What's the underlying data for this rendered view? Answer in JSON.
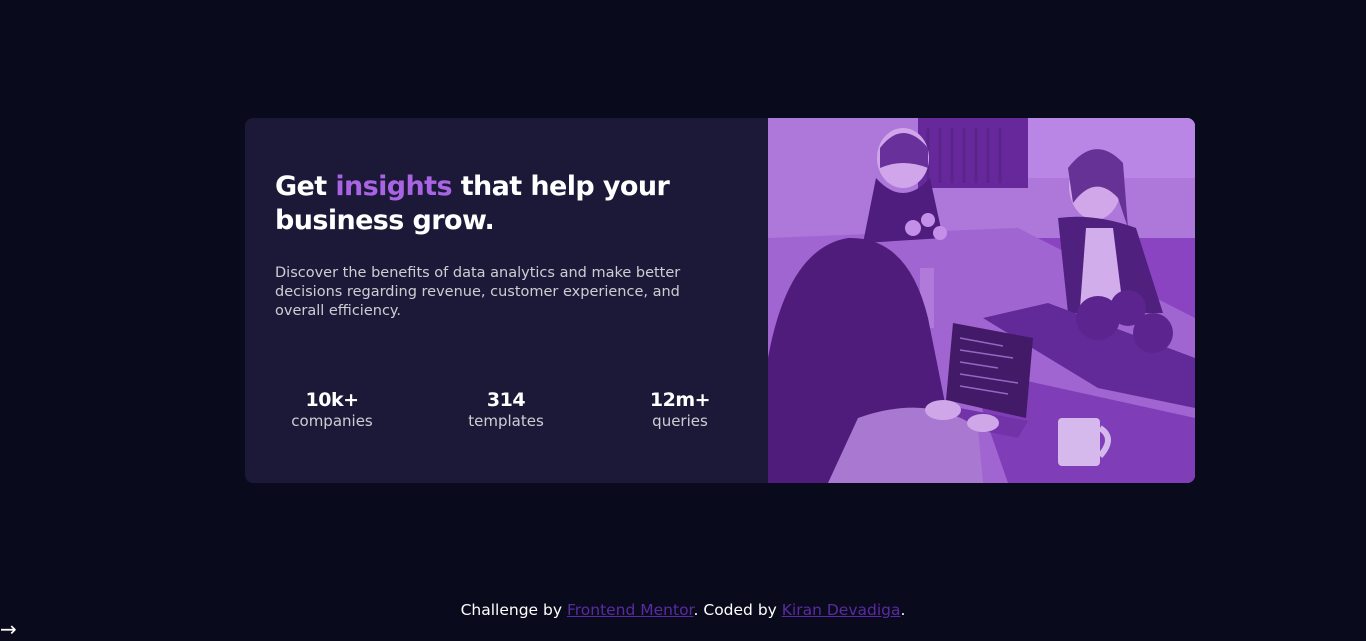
{
  "card": {
    "headline": {
      "part1": "Get ",
      "accent": "insights",
      "part2": " that help your business grow."
    },
    "description": "Discover the benefits of data analytics and make better decisions regarding revenue, customer experience, and overall efficiency.",
    "stats": [
      {
        "value": "10k+",
        "label": "companies"
      },
      {
        "value": "314",
        "label": "templates"
      },
      {
        "value": "12m+",
        "label": "queries"
      }
    ],
    "accent_color": "#a964e4",
    "image_overlay_color": "#8a45c2"
  },
  "footer": {
    "prefix": "Challenge by ",
    "link1": "Frontend Mentor",
    "middle": ". Coded by ",
    "link2": "Kiran Devadiga",
    "suffix": "."
  },
  "arrow": "→",
  "colors": {
    "background": "#090b1c",
    "card": "#1b1937",
    "link": "#5a2aa3"
  }
}
